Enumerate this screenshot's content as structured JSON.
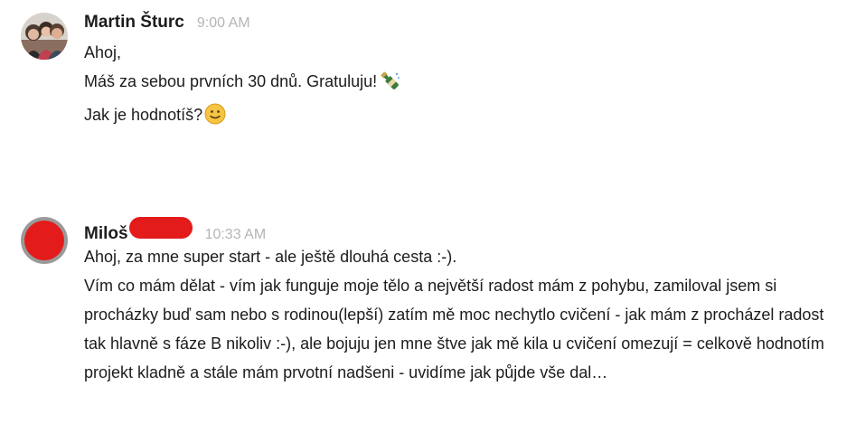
{
  "messages": [
    {
      "author": "Martin Šturc",
      "time": "9:00 AM",
      "lines": [
        "Ahoj,",
        "Máš za sebou prvních 30 dnů. Gratuluju!",
        "Jak je hodnotíš?"
      ],
      "emojis": [
        "champagne-bottle",
        "slightly-smiling-face"
      ]
    },
    {
      "author": "Miloš",
      "time": "10:33 AM",
      "lines": [
        "Ahoj, za mne super start - ale ještě dlouhá cesta :-).",
        "Vím co mám dělat - vím jak funguje moje tělo a největší radost mám z pohybu, zamiloval jsem si procházky buď sam nebo s rodinou(lepší) zatím mě moc nechytlo cvičení - jak mám z procházel radost tak hlavně s fáze B nikoliv :-), ale bojuju jen mne štve jak mě kila u cvičení omezují = celkově hodnotím projekt kladně a stále mám prvotní nadšeni - uvidíme jak půjde vše dal…"
      ]
    }
  ],
  "colors": {
    "author": "#1d1c1d",
    "timestamp": "#b5b5b5",
    "redaction": "#e31b1b"
  }
}
